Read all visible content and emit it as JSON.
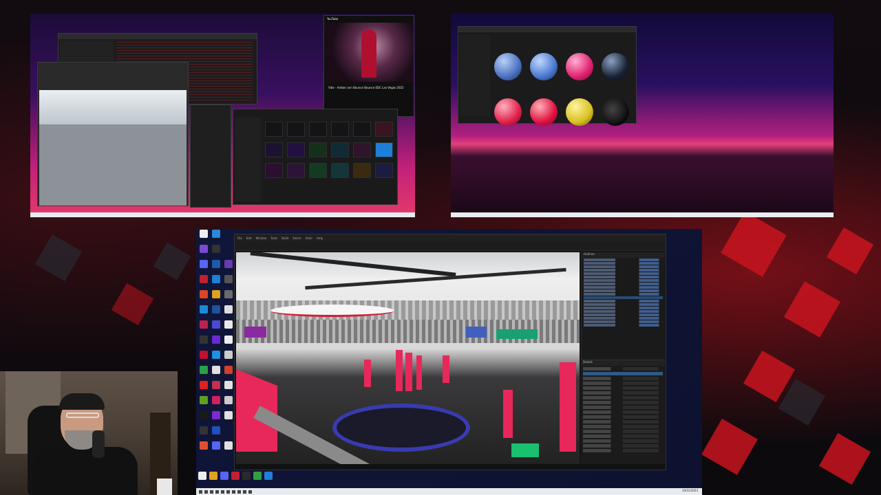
{
  "scene": {
    "description_label": "streamer multi-monitor desktop"
  },
  "left_monitor": {
    "youtube": {
      "brand": "YouTube",
      "video_title": "Vibe - Amber ann Bounce Bounce EDC Las Vegas 2022"
    }
  },
  "main_monitor": {
    "app_menu": [
      "File",
      "Edit",
      "Window",
      "Tools",
      "Build",
      "Select",
      "Actor",
      "Help"
    ],
    "panels": {
      "outliner_title": "Outliner",
      "details_title": "Details"
    },
    "clock": "10/31/2023"
  },
  "colors": {
    "accent_red": "#c8141e",
    "magenta": "#e5407a",
    "ue_dark": "#151515",
    "selection_blue": "#2d5a8a"
  },
  "icons": {
    "desktop": [
      "recycle-bin-icon",
      "chrome-icon",
      "file-explorer-icon",
      "unreal-icon",
      "visual-studio-icon",
      "discord-icon"
    ]
  }
}
